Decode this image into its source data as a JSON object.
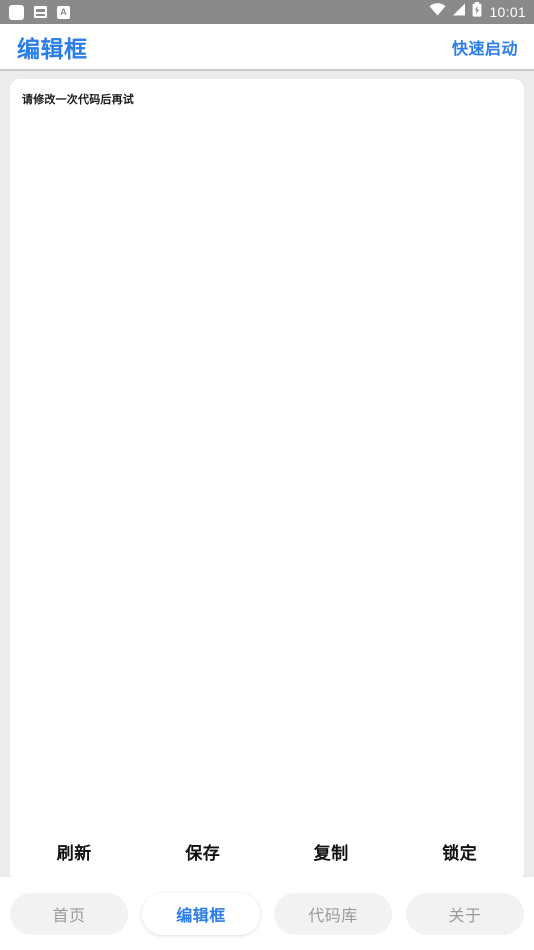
{
  "status_bar": {
    "icons_left": [
      "app-square-icon",
      "message-icon",
      "a-badge-icon"
    ],
    "a_badge_label": "A",
    "icons_right": [
      "wifi-icon",
      "signal-icon",
      "battery-charging-icon"
    ],
    "time": "10:01"
  },
  "header": {
    "title": "编辑框",
    "quick_start_label": "快速启动"
  },
  "editor": {
    "content": "请修改一次代码后再试",
    "placeholder": "请修改一次代码后再试"
  },
  "actions": [
    {
      "label": "刷新",
      "name": "refresh"
    },
    {
      "label": "保存",
      "name": "save"
    },
    {
      "label": "复制",
      "name": "copy"
    },
    {
      "label": "锁定",
      "name": "lock"
    }
  ],
  "tabs": [
    {
      "label": "首页",
      "name": "home",
      "active": false
    },
    {
      "label": "编辑框",
      "name": "editor",
      "active": true
    },
    {
      "label": "代码库",
      "name": "code-library",
      "active": false
    },
    {
      "label": "关于",
      "name": "about",
      "active": false
    }
  ],
  "colors": {
    "accent": "#2b7de9",
    "status_bar_bg": "#8a8a8a",
    "page_bg": "#ececec",
    "tab_inactive_bg": "#f2f2f2",
    "tab_inactive_text": "#9a9a9a",
    "action_text": "#111111"
  }
}
